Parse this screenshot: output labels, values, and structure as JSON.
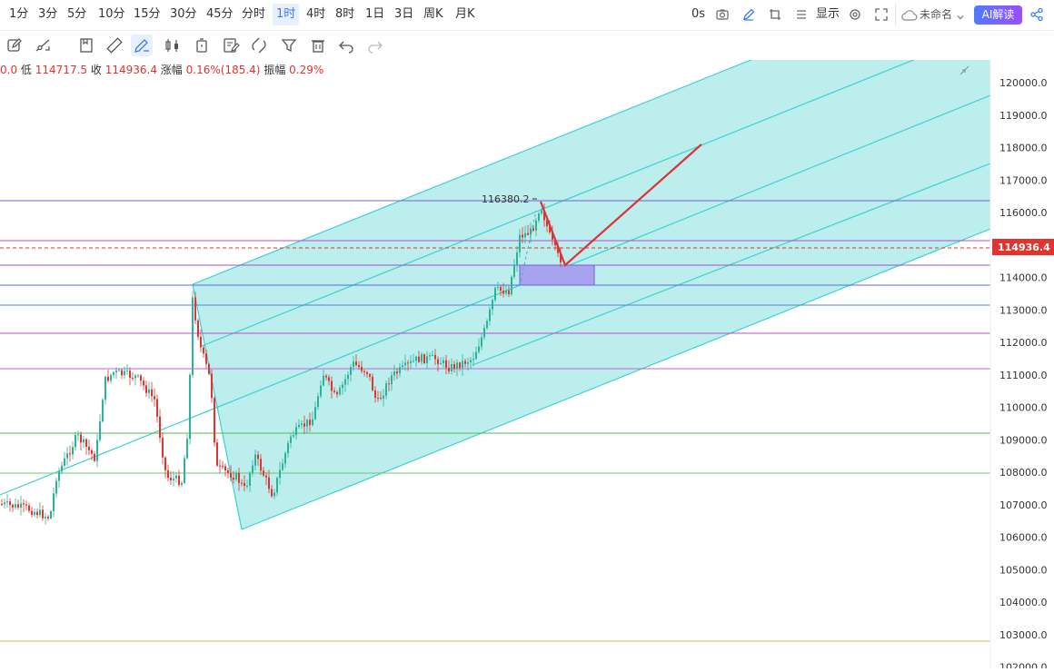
{
  "timeframes": [
    {
      "label": "1分"
    },
    {
      "label": "3分"
    },
    {
      "label": "5分"
    },
    {
      "label": "10分"
    },
    {
      "label": "15分"
    },
    {
      "label": "30分"
    },
    {
      "label": "45分"
    },
    {
      "label": "分时"
    },
    {
      "label": "1时",
      "active": true
    },
    {
      "label": "4时"
    },
    {
      "label": "8时"
    },
    {
      "label": "1日"
    },
    {
      "label": "3日"
    },
    {
      "label": "周K"
    },
    {
      "label": "月K"
    }
  ],
  "top_right": {
    "seconds_label": "0s",
    "display_label": "显示",
    "layout_name": "未命名",
    "ai_label": "AI解读"
  },
  "info": {
    "open_partial": "0.0",
    "low_label": "低",
    "low_value": "114717.5",
    "close_label": "收",
    "close_value": "114936.4",
    "change_label": "涨幅",
    "change_value": "0.16%(185.4)",
    "amp_label": "振幅",
    "amp_value": "0.29%"
  },
  "chart": {
    "current_price_tag": "114936.4",
    "peak_label": "116380.2",
    "price_axis": [
      "120000.0",
      "119000.0",
      "118000.0",
      "117000.0",
      "116000.0",
      "115000.0",
      "114000.0",
      "113000.0",
      "112000.0",
      "111000.0",
      "110000.0",
      "109000.0",
      "108000.0",
      "107000.0",
      "106000.0",
      "105000.0",
      "104000.0",
      "103000.0",
      "102000.0"
    ],
    "colors": {
      "up": "#2bb39a",
      "down": "#e0342f",
      "channel": "#3fd0d0",
      "arrow": "#e0303a"
    }
  }
}
